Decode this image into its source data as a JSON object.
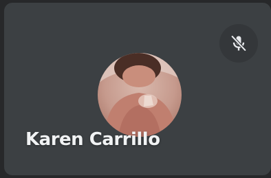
{
  "participant": {
    "name": "Karen Carrillo",
    "avatar_icon": "participant-photo",
    "muted_icon": "microphone-off-icon"
  },
  "colors": {
    "background": "#27282a",
    "tile": "#3c4043",
    "indicator": "#34373a",
    "name_text": "#f1f3f4"
  }
}
